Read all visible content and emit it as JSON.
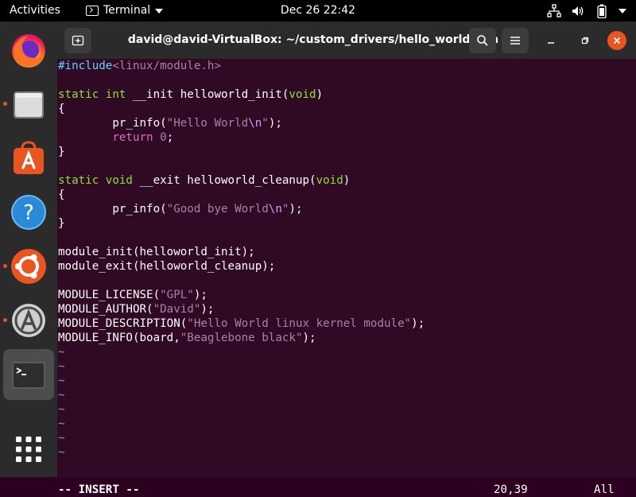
{
  "topbar": {
    "activities": "Activities",
    "app_name": "Terminal",
    "clock": "Dec 26  22:42"
  },
  "dock": {
    "items": [
      "firefox",
      "files",
      "software",
      "help",
      "ubuntu",
      "software-updater",
      "terminal",
      "show-apps"
    ]
  },
  "window": {
    "title": "david@david-VirtualBox: ~/custom_drivers/hello_world_lkm"
  },
  "editor": {
    "lines": [
      {
        "parts": [
          [
            "pre",
            "#include"
          ],
          [
            "str",
            "<linux/module.h>"
          ]
        ]
      },
      {
        "parts": []
      },
      {
        "parts": [
          [
            "kw",
            "static"
          ],
          [
            "",
            " "
          ],
          [
            "kw",
            "int"
          ],
          [
            "",
            " __init helloworld_init("
          ],
          [
            "kw",
            "void"
          ],
          [
            "",
            ")"
          ]
        ]
      },
      {
        "parts": [
          [
            "",
            "{"
          ]
        ]
      },
      {
        "parts": [
          [
            "",
            "        pr_info("
          ],
          [
            "str",
            "\"Hello World"
          ],
          [
            "pp",
            "\\n"
          ],
          [
            "str",
            "\""
          ],
          [
            "",
            ");"
          ]
        ]
      },
      {
        "parts": [
          [
            "",
            "        "
          ],
          [
            "kw2",
            "return"
          ],
          [
            "",
            " "
          ],
          [
            "str",
            "0"
          ],
          [
            "",
            ";"
          ]
        ]
      },
      {
        "parts": [
          [
            "",
            "}"
          ]
        ]
      },
      {
        "parts": []
      },
      {
        "parts": [
          [
            "kw",
            "static"
          ],
          [
            "",
            " "
          ],
          [
            "kw",
            "void"
          ],
          [
            "",
            " __exit helloworld_cleanup("
          ],
          [
            "kw",
            "void"
          ],
          [
            "",
            ")"
          ]
        ]
      },
      {
        "parts": [
          [
            "",
            "{"
          ]
        ]
      },
      {
        "parts": [
          [
            "",
            "        pr_info("
          ],
          [
            "str",
            "\"Good bye World"
          ],
          [
            "pp",
            "\\n"
          ],
          [
            "str",
            "\""
          ],
          [
            "",
            ");"
          ]
        ]
      },
      {
        "parts": [
          [
            "",
            "}"
          ]
        ]
      },
      {
        "parts": []
      },
      {
        "parts": [
          [
            "",
            "module_init(helloworld_init);"
          ]
        ]
      },
      {
        "parts": [
          [
            "",
            "module_exit(helloworld_cleanup);"
          ]
        ]
      },
      {
        "parts": []
      },
      {
        "parts": [
          [
            "",
            "MODULE_LICENSE("
          ],
          [
            "str",
            "\"GPL\""
          ],
          [
            "",
            ");"
          ]
        ]
      },
      {
        "parts": [
          [
            "",
            "MODULE_AUTHOR("
          ],
          [
            "str",
            "\"David\""
          ],
          [
            "",
            ");"
          ]
        ]
      },
      {
        "parts": [
          [
            "",
            "MODULE_DESCRIPTION("
          ],
          [
            "str",
            "\"Hello World linux kernel module\""
          ],
          [
            "",
            ");"
          ]
        ]
      },
      {
        "parts": [
          [
            "",
            "MODULE_INFO(board,"
          ],
          [
            "str",
            "\"Beaglebone black\""
          ],
          [
            "",
            ");"
          ]
        ]
      },
      {
        "parts": [
          [
            "tilde",
            "~"
          ]
        ]
      },
      {
        "parts": [
          [
            "tilde",
            "~"
          ]
        ]
      },
      {
        "parts": [
          [
            "tilde",
            "~"
          ]
        ]
      },
      {
        "parts": [
          [
            "tilde",
            "~"
          ]
        ]
      },
      {
        "parts": [
          [
            "tilde",
            "~"
          ]
        ]
      },
      {
        "parts": [
          [
            "tilde",
            "~"
          ]
        ]
      },
      {
        "parts": [
          [
            "tilde",
            "~"
          ]
        ]
      },
      {
        "parts": [
          [
            "tilde",
            "~"
          ]
        ]
      }
    ],
    "status_mode": "-- INSERT --",
    "status_position": "20,39",
    "status_scroll": "All"
  },
  "colors": {
    "accent": "#e95420",
    "terminal_bg": "#300a24"
  }
}
